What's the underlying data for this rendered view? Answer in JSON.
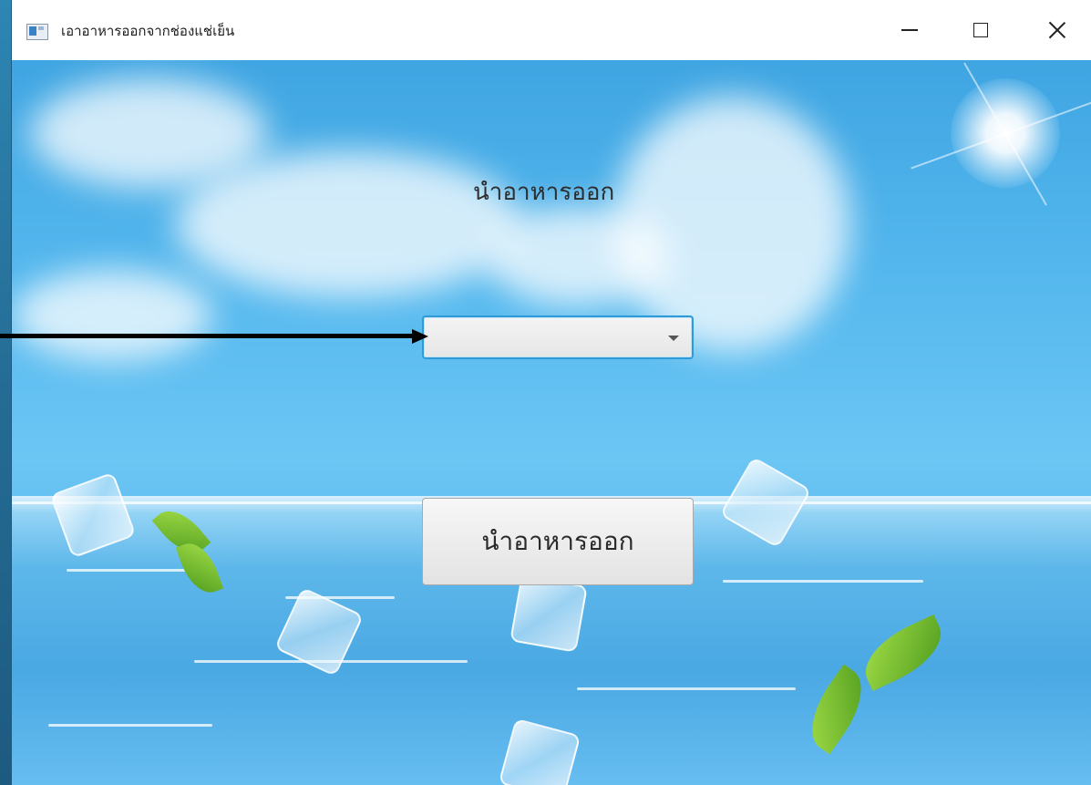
{
  "window": {
    "title": "เอาอาหารออกจากช่องแช่เย็น",
    "controls": [
      "minimize",
      "maximize",
      "close"
    ]
  },
  "main": {
    "heading": "นำอาหารออก",
    "food_select": {
      "value": ""
    },
    "action_button_label": "นำอาหารออก"
  },
  "icons": {
    "app": "app-window-icon",
    "minimize": "minimize-icon",
    "maximize": "maximize-icon",
    "close": "close-icon",
    "dropdown": "chevron-down-icon"
  },
  "colors": {
    "focus_border": "#2e9ad8",
    "sky": "#55b8ee",
    "annotation_arrow": "#000000"
  }
}
